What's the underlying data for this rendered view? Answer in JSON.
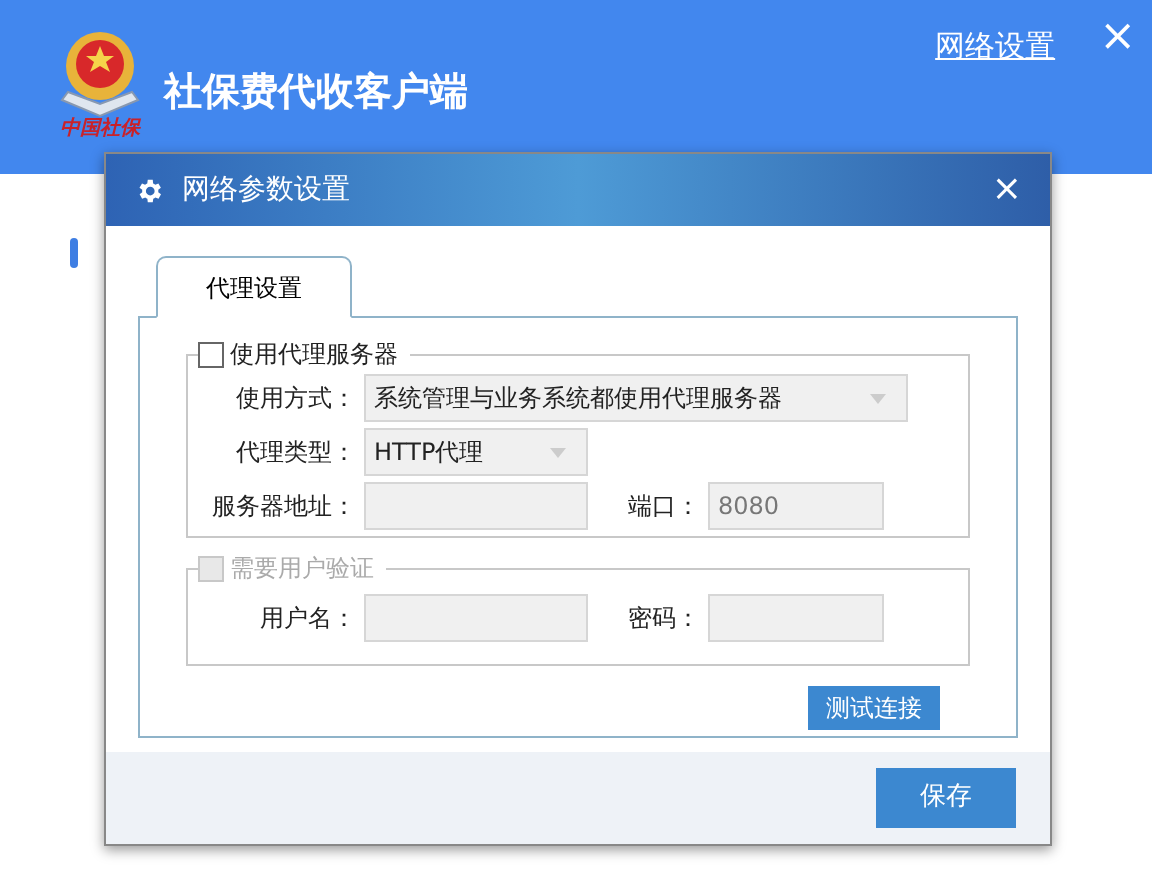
{
  "app": {
    "title": "社保费代收客户端",
    "logo_caption": "中国社保",
    "header_link": "网络设置",
    "close": "×"
  },
  "dialog": {
    "title": "网络参数设置",
    "close": "×",
    "tabs": [
      {
        "label": "代理设置",
        "selected": true
      }
    ],
    "proxy_group": {
      "label": "使用代理服务器",
      "checked": false,
      "fields": [
        {
          "kind": "select",
          "label": "使用方式：",
          "value": "系统管理与业务系统都使用代理服务器"
        },
        {
          "kind": "select",
          "label": "代理类型：",
          "value": "HTTP代理"
        },
        {
          "kind": "input",
          "label": "服务器地址："
        },
        {
          "kind": "input",
          "label": "端口：",
          "value": "8080"
        }
      ]
    },
    "auth_group": {
      "label": "需要用户验证",
      "checked": false,
      "disabled": true,
      "fields": [
        {
          "kind": "input",
          "label": "用户名："
        },
        {
          "kind": "input",
          "label": "密码："
        }
      ]
    },
    "test_button": "测试连接",
    "save_button": "保存"
  }
}
